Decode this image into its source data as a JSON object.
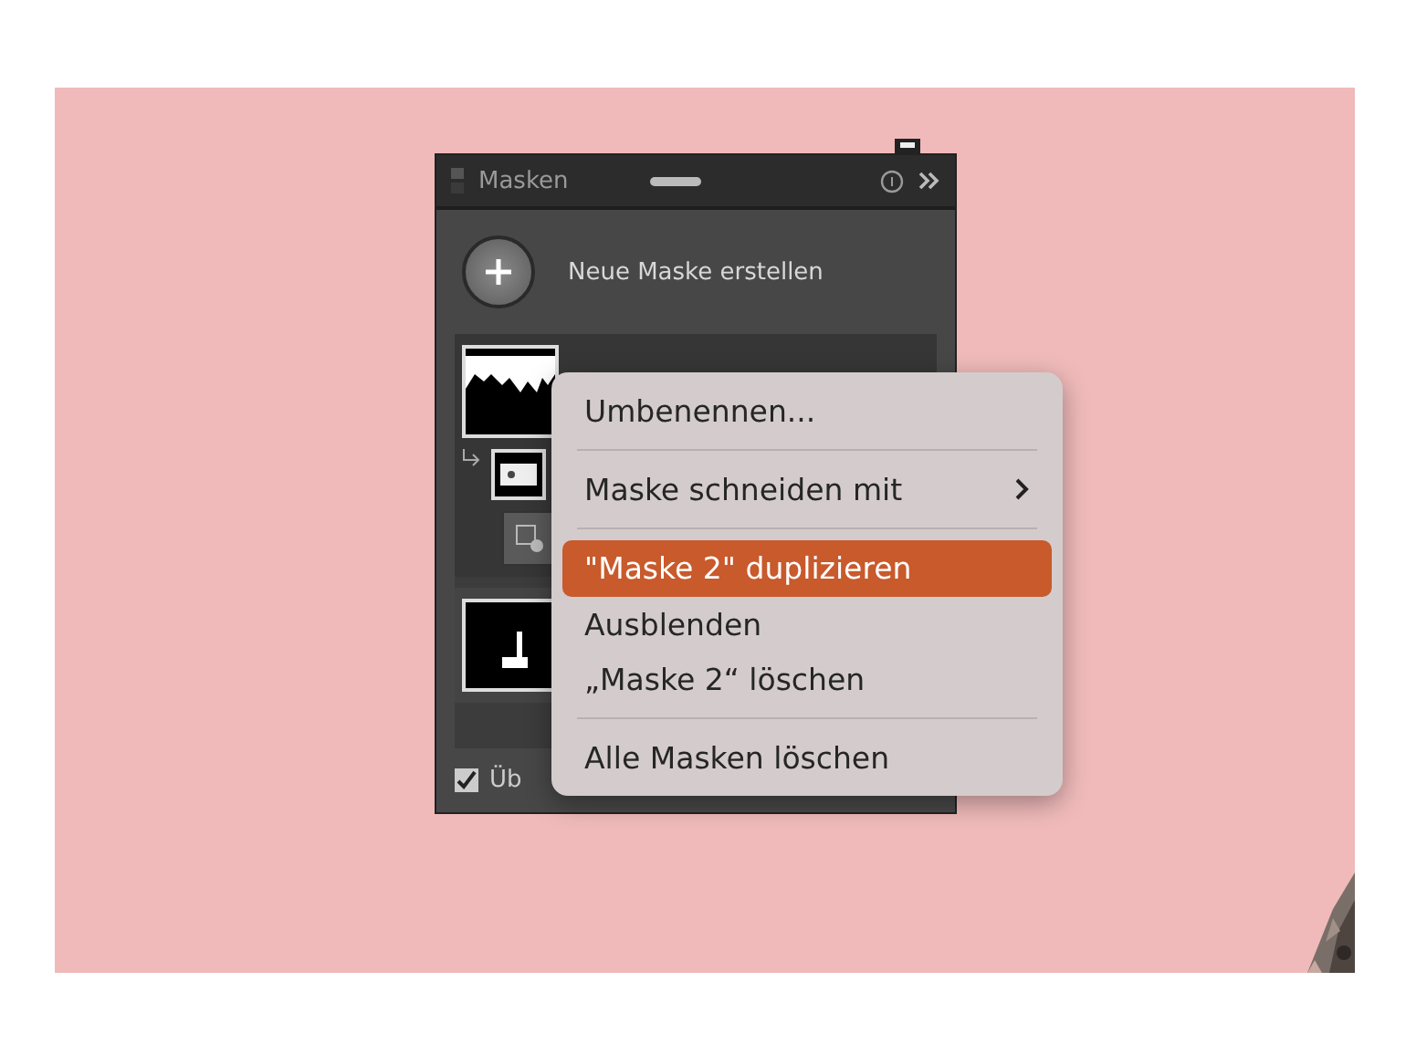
{
  "panel": {
    "title": "Masken",
    "new_mask_label": "Neue Maske erstellen",
    "masks": [
      {
        "selected": true,
        "has_subitem": true
      },
      {
        "selected": false,
        "has_subitem": false
      }
    ],
    "overlay_checkbox": {
      "label": "Üb",
      "checked": true
    }
  },
  "context_menu": {
    "groups": [
      [
        {
          "label": "Umbenennen...",
          "selected": false,
          "has_submenu": false
        }
      ],
      [
        {
          "label": "Maske schneiden mit",
          "selected": false,
          "has_submenu": true
        }
      ],
      [
        {
          "label": "\"Maske 2\" duplizieren",
          "selected": true,
          "has_submenu": false
        },
        {
          "label": "Ausblenden",
          "selected": false,
          "has_submenu": false
        },
        {
          "label": "„Maske 2“ löschen",
          "selected": false,
          "has_submenu": false
        }
      ],
      [
        {
          "label": "Alle Masken löschen",
          "selected": false,
          "has_submenu": false
        }
      ]
    ]
  }
}
